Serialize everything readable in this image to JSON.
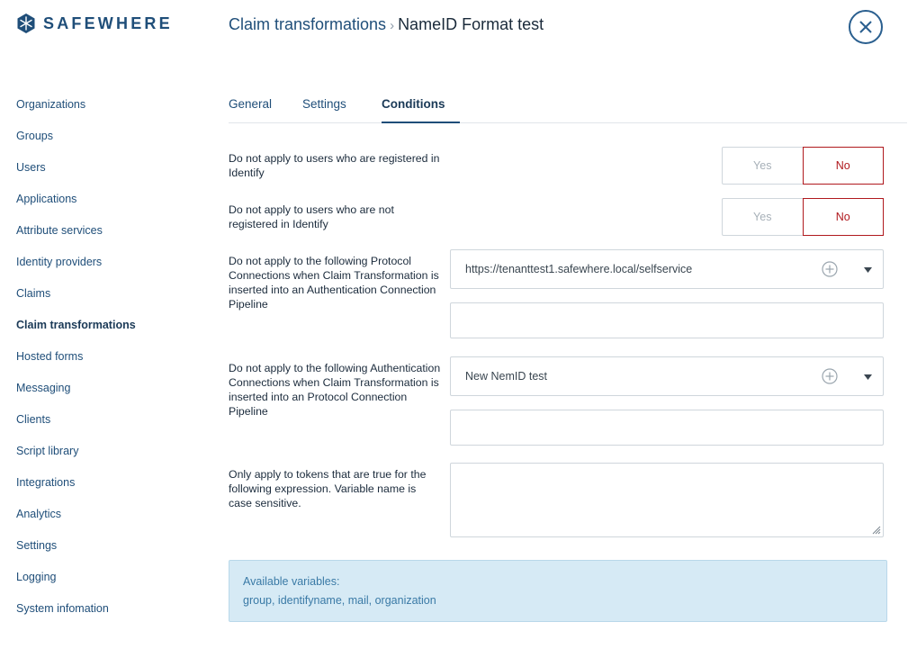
{
  "brand": {
    "name": "SAFEWHERE",
    "color": "#1f4e79"
  },
  "header": {
    "breadcrumb_parent": "Claim transformations",
    "breadcrumb_sep": "›",
    "breadcrumb_current": "NameID Format test",
    "close_icon": "close-circle-icon"
  },
  "sidebar": {
    "items": [
      {
        "label": "Organizations"
      },
      {
        "label": "Groups"
      },
      {
        "label": "Users"
      },
      {
        "label": "Applications"
      },
      {
        "label": "Attribute services"
      },
      {
        "label": "Identity providers"
      },
      {
        "label": "Claims"
      },
      {
        "label": "Claim transformations",
        "active": true
      },
      {
        "label": "Hosted forms"
      },
      {
        "label": "Messaging"
      },
      {
        "label": "Clients"
      },
      {
        "label": "Script library"
      },
      {
        "label": "Integrations"
      },
      {
        "label": "Analytics"
      },
      {
        "label": "Settings"
      },
      {
        "label": "Logging"
      },
      {
        "label": "System infomation"
      }
    ]
  },
  "tabs": [
    {
      "label": "General"
    },
    {
      "label": "Settings"
    },
    {
      "label": "Conditions",
      "active": true
    }
  ],
  "conditions": {
    "registered": {
      "label": "Do not apply to users who are registered in Identify",
      "yes": "Yes",
      "no": "No",
      "selected": "No"
    },
    "not_registered": {
      "label": "Do not apply to users who are not registered in Identify",
      "yes": "Yes",
      "no": "No",
      "selected": "No"
    },
    "protocol_connections": {
      "label": "Do not apply to the following Protocol Connections when Claim Transformation is inserted into an Authentication Connection Pipeline",
      "selected": "https://tenanttest1.safewhere.local/selfservice",
      "list_value": ""
    },
    "auth_connections": {
      "label": "Do not apply to the following Authentication Connections when Claim Transformation is inserted into an Protocol Connection Pipeline",
      "selected": "New NemID test",
      "list_value": ""
    },
    "expression": {
      "label": "Only apply to tokens that are true for the following expression. Variable name is case sensitive.",
      "value": ""
    },
    "variables": {
      "title": "Available variables:",
      "list": "group, identifyname, mail, organization"
    }
  },
  "colors": {
    "accent": "#1f4e79",
    "danger": "#b0191e",
    "info_bg": "#d6eaf5",
    "info_text": "#3a7aa6"
  }
}
